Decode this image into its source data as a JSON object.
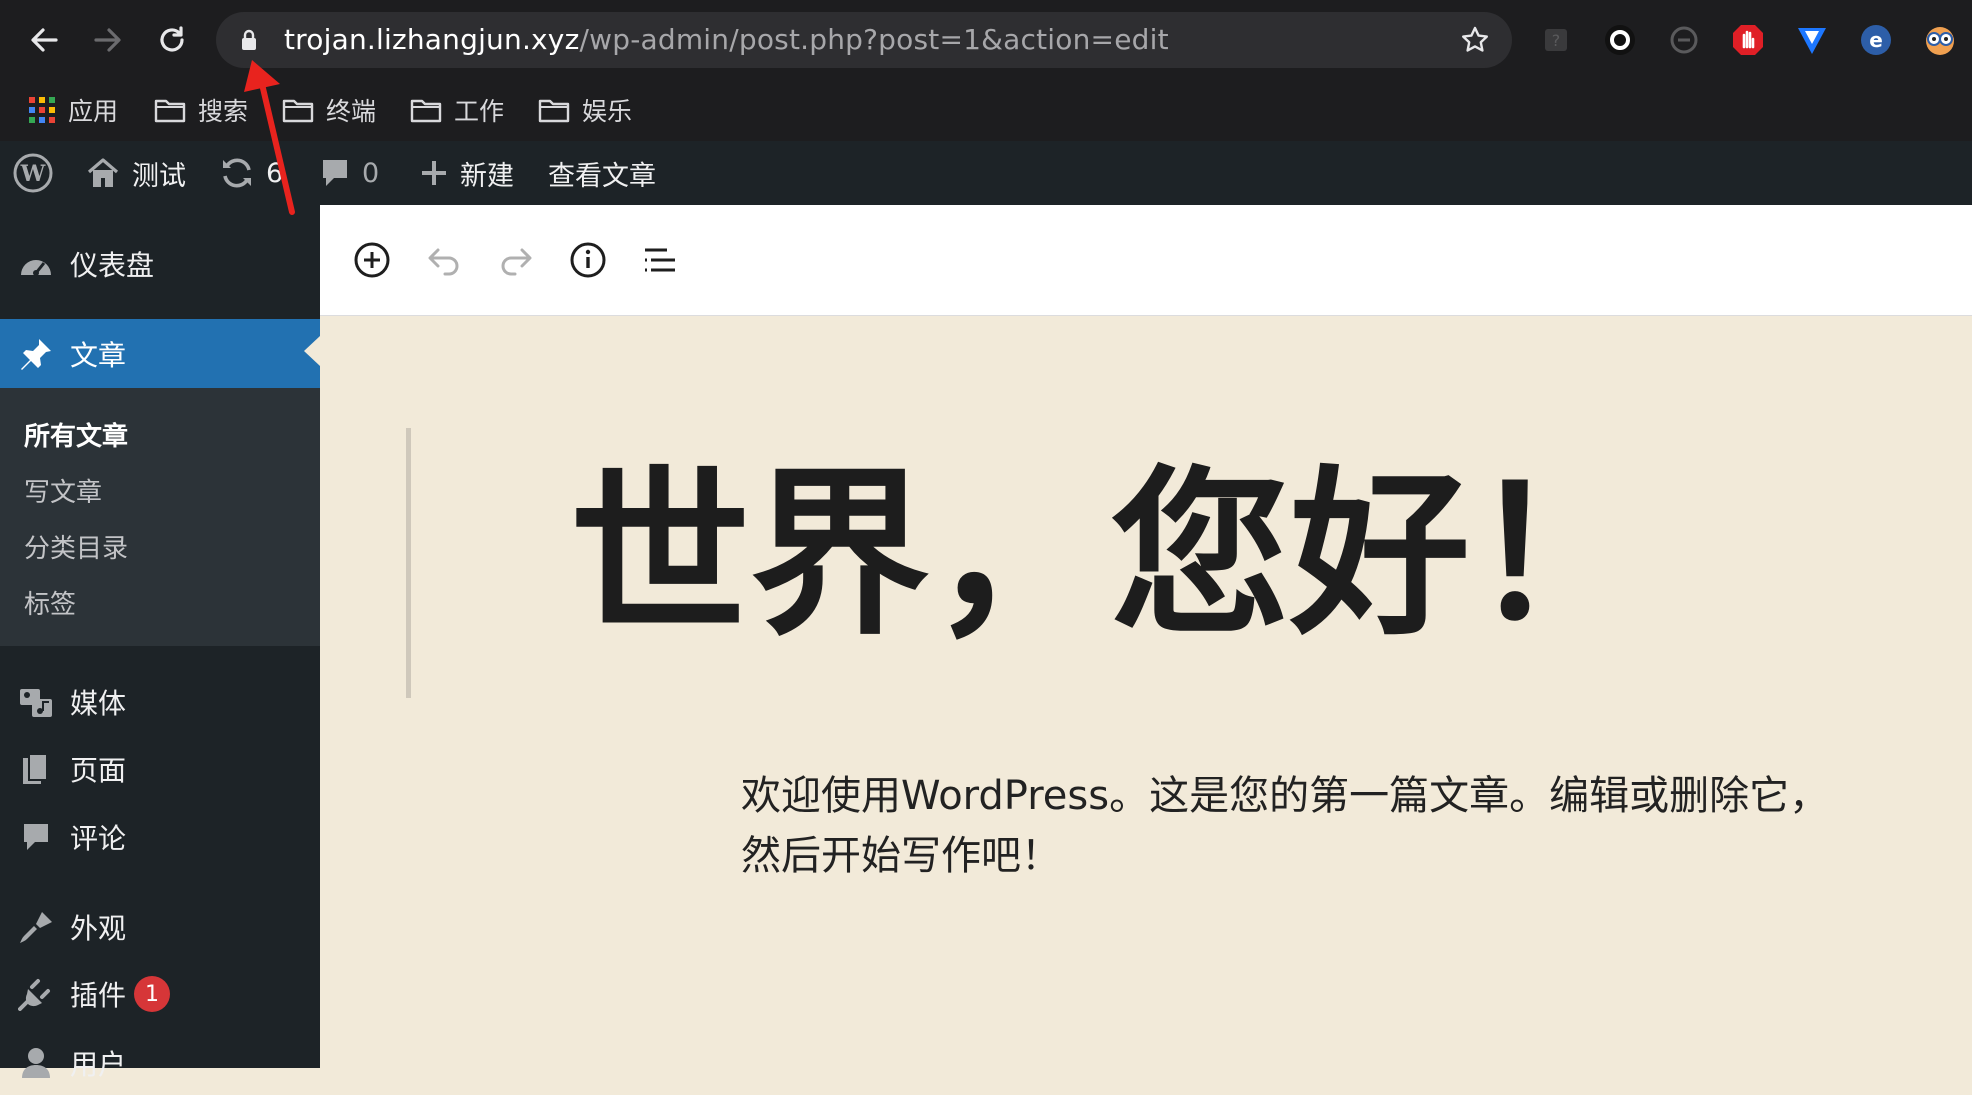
{
  "browser": {
    "url_host": "trojan.lizhangjun.xyz",
    "url_path": "/wp-admin/post.php?post=1&action=edit",
    "extension_icons": [
      "puzzle-icon",
      "record-icon",
      "sync-icon",
      "adblock-hand-icon",
      "shield-v-icon",
      "e-icon",
      "owl-icon"
    ]
  },
  "bookmarks": [
    {
      "label": "应用",
      "icon": "apps-grid-icon"
    },
    {
      "label": "搜索",
      "icon": "folder-icon"
    },
    {
      "label": "终端",
      "icon": "folder-icon"
    },
    {
      "label": "工作",
      "icon": "folder-icon"
    },
    {
      "label": "娱乐",
      "icon": "folder-icon"
    }
  ],
  "adminbar": {
    "site_name": "测试",
    "updates_count": "6",
    "comments_count": "0",
    "new_label": "新建",
    "view_post_label": "查看文章"
  },
  "sidebar": {
    "items": [
      {
        "label": "仪表盘",
        "icon": "dashboard-icon"
      },
      {
        "label": "文章",
        "icon": "pin-icon"
      },
      {
        "label": "媒体",
        "icon": "media-icon"
      },
      {
        "label": "页面",
        "icon": "pages-icon"
      },
      {
        "label": "评论",
        "icon": "comment-icon"
      },
      {
        "label": "外观",
        "icon": "brush-icon"
      },
      {
        "label": "插件",
        "icon": "plugin-icon",
        "badge": "1"
      },
      {
        "label": "用户",
        "icon": "user-icon"
      }
    ],
    "submenu": [
      "所有文章",
      "写文章",
      "分类目录",
      "标签"
    ]
  },
  "editor": {
    "toolbar_icons": [
      "add-block-icon",
      "undo-icon",
      "redo-icon",
      "info-icon",
      "outline-icon"
    ],
    "title": "世界，您好！",
    "body_line1": "欢迎使用WordPress。这是您的第一篇文章。编辑或删除它，",
    "body_line2": "然后开始写作吧！"
  },
  "colors": {
    "admin_dark": "#1d2327",
    "admin_blue": "#2271b1",
    "canvas_bg": "#f2ead9",
    "badge_red": "#d63638",
    "annotation_red": "#e8231e"
  }
}
